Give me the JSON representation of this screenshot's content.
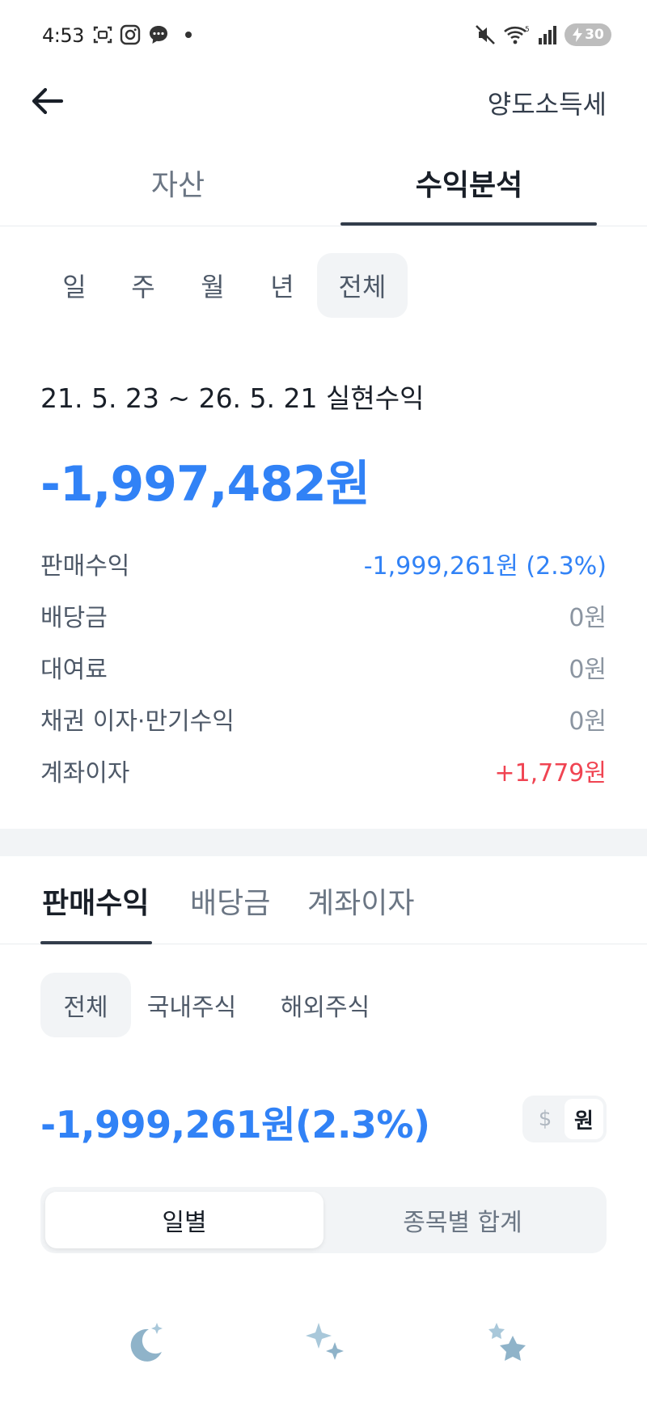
{
  "status_bar": {
    "time": "4:53",
    "battery": "30"
  },
  "header": {
    "tax_label": "양도소득세"
  },
  "main_tabs": [
    {
      "label": "자산",
      "active": false
    },
    {
      "label": "수익분석",
      "active": true
    }
  ],
  "periods": [
    {
      "label": "일",
      "active": false
    },
    {
      "label": "주",
      "active": false
    },
    {
      "label": "월",
      "active": false
    },
    {
      "label": "년",
      "active": false
    },
    {
      "label": "전체",
      "active": true
    }
  ],
  "summary": {
    "range_label": "21. 5. 23 ~ 26. 5. 21 실현수익",
    "total": "-1,997,482원",
    "rows": [
      {
        "label": "판매수익",
        "value": "-1,999,261원 (2.3%)",
        "tone": "neg"
      },
      {
        "label": "배당금",
        "value": "0원",
        "tone": "zero"
      },
      {
        "label": "대여료",
        "value": "0원",
        "tone": "zero"
      },
      {
        "label": "채권 이자·만기수익",
        "value": "0원",
        "tone": "zero"
      },
      {
        "label": "계좌이자",
        "value": "+1,779원",
        "tone": "pos"
      }
    ]
  },
  "sub_tabs": [
    {
      "label": "판매수익",
      "active": true
    },
    {
      "label": "배당금",
      "active": false
    },
    {
      "label": "계좌이자",
      "active": false
    }
  ],
  "market_chips": [
    {
      "label": "전체",
      "active": true
    },
    {
      "label": "국내주식",
      "active": false
    },
    {
      "label": "해외주식",
      "active": false
    }
  ],
  "sell_total": "-1,999,261원(2.3%)",
  "currency_toggle": {
    "dollar": "$",
    "won": "원",
    "selected": "won"
  },
  "segment": {
    "daily": "일별",
    "by_stock": "종목별 합계",
    "selected": "daily"
  },
  "colors": {
    "accent_blue": "#3182f6",
    "positive_red": "#f04452",
    "deco_blue": "#8fb3c9"
  }
}
